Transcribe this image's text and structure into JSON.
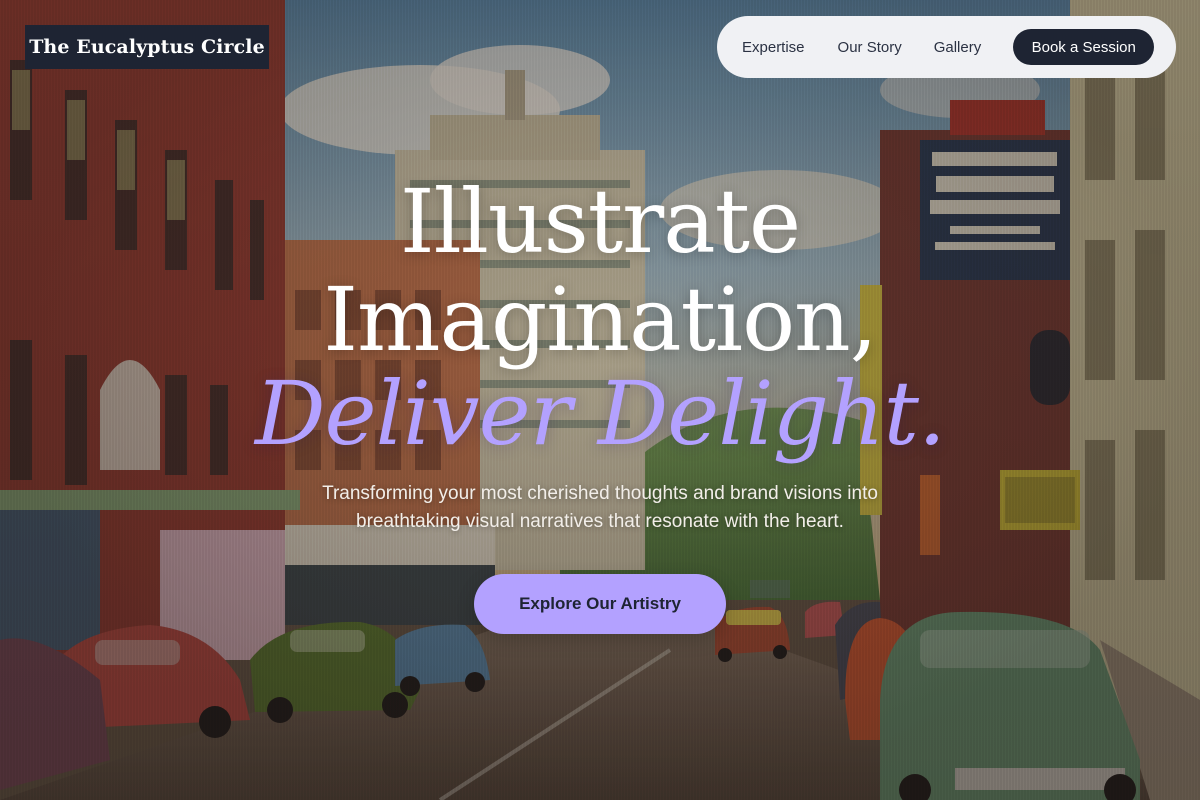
{
  "brand": {
    "name": "The Eucalyptus Circle"
  },
  "nav": {
    "links": [
      {
        "label": "Expertise"
      },
      {
        "label": "Our Story"
      },
      {
        "label": "Gallery"
      }
    ],
    "cta_label": "Book a Session"
  },
  "hero": {
    "line1": "Illustrate",
    "line2": "Imagination,",
    "line3": "Deliver Delight.",
    "subtitle_line1": "Transforming your most cherished thoughts and brand visions into",
    "subtitle_line2": "breathtaking visual narratives that resonate with the heart.",
    "cta_label": "Explore Our Artistry"
  },
  "colors": {
    "dark_navy": "#1e2433",
    "nav_bg": "#f0f1f4",
    "accent_lavender": "#b3a1ff",
    "white": "#ffffff"
  }
}
